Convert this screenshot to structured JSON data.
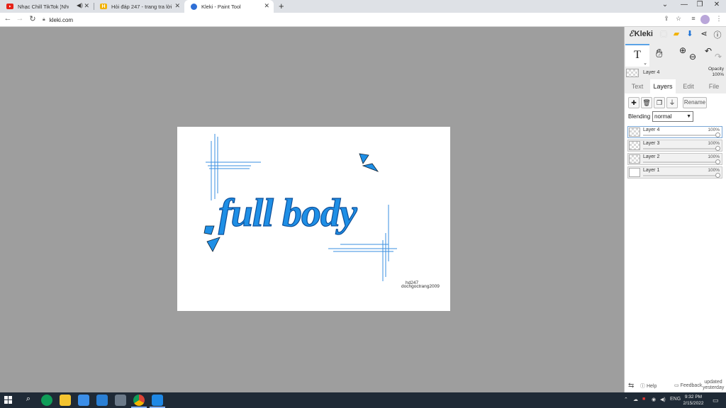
{
  "browser": {
    "tabs": [
      {
        "title": "Nhạc Chill TikTok ¦Những",
        "favicon": "youtube-icon",
        "active": false,
        "muted_icon": "speaker-icon"
      },
      {
        "title": "Hỏi đáp 247 - trang tra lời",
        "favicon": "hoidap-icon",
        "active": false
      },
      {
        "title": "Kleki - Paint Tool",
        "favicon": "kleki-icon",
        "active": true
      }
    ],
    "new_tab": "+",
    "url": "kleki.com"
  },
  "canvas": {
    "artwork_text": "full body",
    "watermark_line1": "hd247",
    "watermark_line2": "dochgoctrang2009",
    "accent_color": "#1e8fe6"
  },
  "panel": {
    "logo": "Kleki",
    "current_layer": "Layer 4",
    "opacity_label": "Opacity",
    "opacity_value": "100%",
    "tabs": [
      "Text",
      "Layers",
      "Edit",
      "File"
    ],
    "selected_tab": "Layers",
    "rename_label": "Rename",
    "blending_label": "Blending",
    "blending_value": "normal",
    "layers": [
      {
        "name": "Layer 4",
        "opacity": "100%",
        "active": true
      },
      {
        "name": "Layer 3",
        "opacity": "100%",
        "active": false
      },
      {
        "name": "Layer 2",
        "opacity": "100%",
        "active": false
      },
      {
        "name": "Layer 1",
        "opacity": "100%",
        "active": false
      }
    ],
    "help_label": "Help",
    "feedback_label": "Feedback",
    "updated_line1": "updated",
    "updated_line2": "yesterday"
  },
  "taskbar": {
    "language": "ENG",
    "time": "9:32 PM",
    "date": "2/15/2022"
  }
}
